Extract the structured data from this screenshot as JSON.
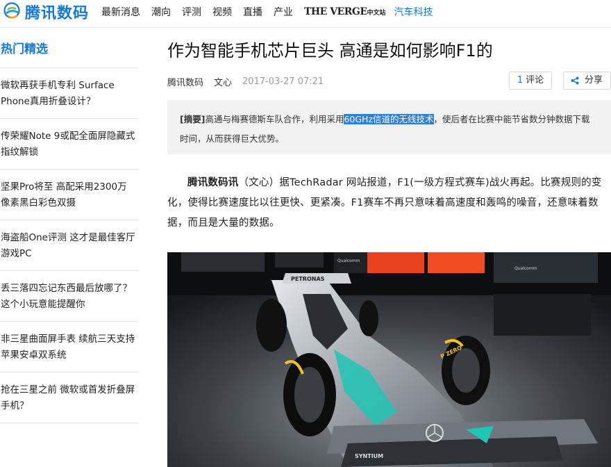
{
  "header": {
    "logo_text": "腾讯数码",
    "nav": [
      {
        "label": "最新消息"
      },
      {
        "label": "潮向"
      },
      {
        "label": "评测"
      },
      {
        "label": "视频"
      },
      {
        "label": "直播"
      },
      {
        "label": "产业"
      }
    ],
    "verge": {
      "label": "THE VERGE",
      "suffix": "中文站"
    },
    "nav_active": {
      "label": "汽车科技"
    }
  },
  "sidebar": {
    "title": "热门精选",
    "items": [
      {
        "label": "微软再获手机专利 Surface Phone真用折叠设计？"
      },
      {
        "label": "传荣耀Note 9或配全面屏隐藏式指纹解锁"
      },
      {
        "label": "坚果Pro将至 高配采用2300万像素黑白彩色双摄"
      },
      {
        "label": "海盗船One评测 这才是最佳客厅游戏PC"
      },
      {
        "label": "丢三落四忘记东西最后放哪了？这个小玩意能提醒你"
      },
      {
        "label": "非三星曲面屏手表 续航三天支持苹果安卓双系统"
      },
      {
        "label": "抢在三星之前 微软或首发折叠屏手机？"
      }
    ]
  },
  "article": {
    "title": "作为智能手机芯片巨头 高通是如何影响F1的",
    "source": "腾讯数码",
    "author": "文心",
    "time": "2017-03-27 07:21",
    "comment_count": "1",
    "comment_label": "评论",
    "share_label": "分享",
    "summary": {
      "tag": "[摘要]",
      "text_before": "高通与梅赛德斯车队合作，利用采用",
      "highlight": "60GHz信道的无线技术",
      "text_after": "，使后者在比赛中能节省数分钟数据下载时间，从而获得巨大优势。"
    },
    "paragraph": {
      "lead": "腾讯数码讯",
      "text": "（文心）据TechRadar 网站报道，F1(一级方程式赛车)战火再起。比赛规则的变化，使得比赛速度比以往更快、更紧凑。F1赛车不再只意味着高速度和轰鸣的噪音，还意味着数据，而且是大量的数据。"
    },
    "photo": {
      "tv_brand": "Qualcomm",
      "car_brand": "PETRONAS",
      "tyre_text": "P ZERO",
      "sponsor": "SYNTIUM"
    }
  },
  "colors": {
    "brand_blue": "#1479d7",
    "highlight_bg": "#2f7fd8",
    "summary_bg": "#f2f2f2"
  }
}
